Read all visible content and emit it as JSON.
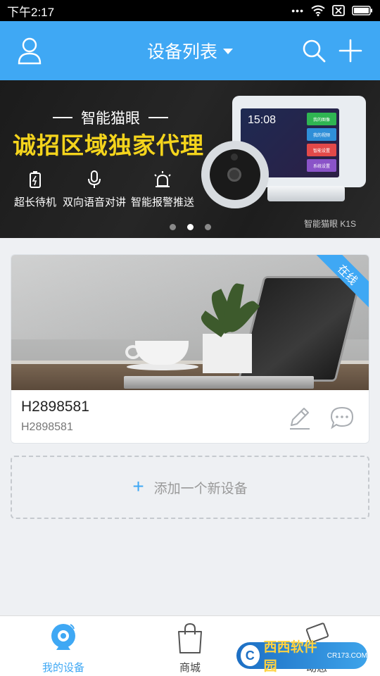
{
  "status_bar": {
    "time": "下午2:17",
    "icons": [
      "more-dots-icon",
      "wifi-icon",
      "sim-x-icon",
      "battery-icon"
    ]
  },
  "header": {
    "title": "设备列表",
    "left_icon": "user-icon",
    "right_icons": [
      "search-icon",
      "plus-icon"
    ]
  },
  "banner": {
    "subtitle": "智能猫眼",
    "headline": "诚招区域独家代理",
    "features": [
      {
        "icon": "battery-icon",
        "label": "超长待机"
      },
      {
        "icon": "microphone-icon",
        "label": "双向语音对讲"
      },
      {
        "icon": "alarm-icon",
        "label": "智能报警推送"
      }
    ],
    "device_time": "15:08",
    "device_tiles": [
      "我的图像",
      "我的视频",
      "智能设置",
      "系统设置"
    ],
    "brand": "智能猫眼 K1S",
    "page_count": 3,
    "active_page": 2
  },
  "device": {
    "name": "H2898581",
    "id": "H2898581",
    "status": "在线",
    "actions": [
      "edit-icon",
      "chat-icon"
    ]
  },
  "add_device": {
    "label": "添加一个新设备"
  },
  "bottom_nav": {
    "items": [
      {
        "label": "我的设备",
        "icon": "camera-icon",
        "active": true
      },
      {
        "label": "商城",
        "icon": "shopping-bag-icon",
        "active": false
      },
      {
        "label": "动态",
        "icon": "feed-icon",
        "active": false
      }
    ]
  },
  "watermark": {
    "brand": "西西软件园",
    "url": "CR173.COM"
  },
  "colors": {
    "accent": "#3fa8f4",
    "banner_headline": "#f4d41c"
  }
}
